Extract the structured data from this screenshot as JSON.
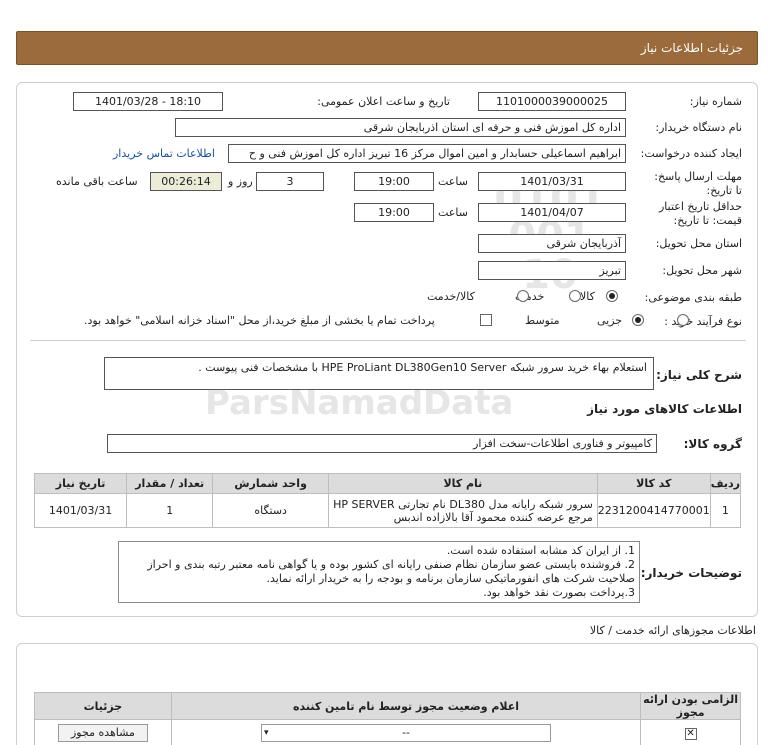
{
  "header": {
    "title": "جزئیات اطلاعات نیاز"
  },
  "form": {
    "need_number_label": "شماره نیاز:",
    "need_number": "1101000039000025",
    "announce_label": "تاریخ و ساعت اعلان عمومی:",
    "announce_value": "1401/03/28 - 18:10",
    "buyer_org_label": "نام دستگاه خریدار:",
    "buyer_org": "اداره کل اموزش فنی و حرفه ای استان اذربایجان شرقی",
    "creator_label": "ایجاد کننده درخواست:",
    "creator": "ابراهیم اسماعیلی حسابدار و امین اموال مرکز 16 تبریز اداره کل اموزش فنی و ح",
    "contact_link": "اطلاعات تماس خریدار",
    "deadline_label": "مهلت ارسال پاسخ: تا تاریخ:",
    "deadline_date": "1401/03/31",
    "time_label": "ساعت",
    "deadline_time": "19:00",
    "days_value": "3",
    "days_label": "روز و",
    "remaining_time": "00:26:14",
    "remaining_label": "ساعت باقی مانده",
    "price_valid_label": "حداقل تاریخ اعتبار قیمت: تا تاریخ:",
    "price_valid_date": "1401/04/07",
    "price_valid_time": "19:00",
    "delivery_province_label": "استان محل تحویل:",
    "delivery_province": "آذربایجان شرقی",
    "delivery_city_label": "شهر محل تحویل:",
    "delivery_city": "تبریز",
    "category_label": "طبقه بندی موضوعی:",
    "category_options": [
      "کالا",
      "خدمت",
      "کالا/خدمت"
    ],
    "process_label": "نوع فرآیند خرید :",
    "process_options": [
      "جزیی",
      "متوسط"
    ],
    "payment_note": "پرداخت تمام یا بخشی از مبلغ خرید،از محل \"اسناد خزانه اسلامی\" خواهد بود."
  },
  "description": {
    "label": "شرح کلی نیاز:",
    "text": "استعلام بهاء خرید سرور شبکه HPE ProLiant DL380Gen10 Server با مشخصات فنی پیوست ."
  },
  "goods": {
    "section_title": "اطلاعات کالاهای مورد نیاز",
    "group_label": "گروه کالا:",
    "group_value": "کامپیوتر و فناوری اطلاعات-سخت افزار",
    "columns": [
      "ردیف",
      "کد کالا",
      "نام کالا",
      "واحد شمارش",
      "تعداد / مقدار",
      "تاریخ نیاز"
    ],
    "rows": [
      {
        "row": "1",
        "code": "2231200414770001",
        "name": "سرور شبکه رایانه مدل DL380 نام تجارتی HP SERVER مرجع عرضه کننده محمود آقا بالازاده اندبس",
        "unit": "دستگاه",
        "qty": "1",
        "date": "1401/03/31"
      }
    ]
  },
  "buyer_notes": {
    "label": "توضیحات خریدار:",
    "lines": [
      "1. از ایران کد مشابه استفاده شده است.",
      "2. فروشنده بایستی عضو سازمان نظام صنفی رایانه ای کشور بوده و یا گواهی نامه معتبر رتبه بندی و احراز صلاحیت شرکت های انفورماتیکی سازمان برنامه و بودجه را به خریدار ارائه نماید.",
      "3.پرداخت بصورت نقد خواهد بود."
    ]
  },
  "permits": {
    "section_title": "اطلاعات مجوزهای ارائه خدمت / کالا",
    "columns": [
      "الزامی بودن ارائه مجوز",
      "اعلام وضعیت مجوز توسط نام تامین کننده",
      "جزئیات"
    ],
    "row_select": "--",
    "view_button": "مشاهده مجوز"
  },
  "watermark": {
    "brand": "ParsNamadData",
    "number": "0101 001 10"
  }
}
